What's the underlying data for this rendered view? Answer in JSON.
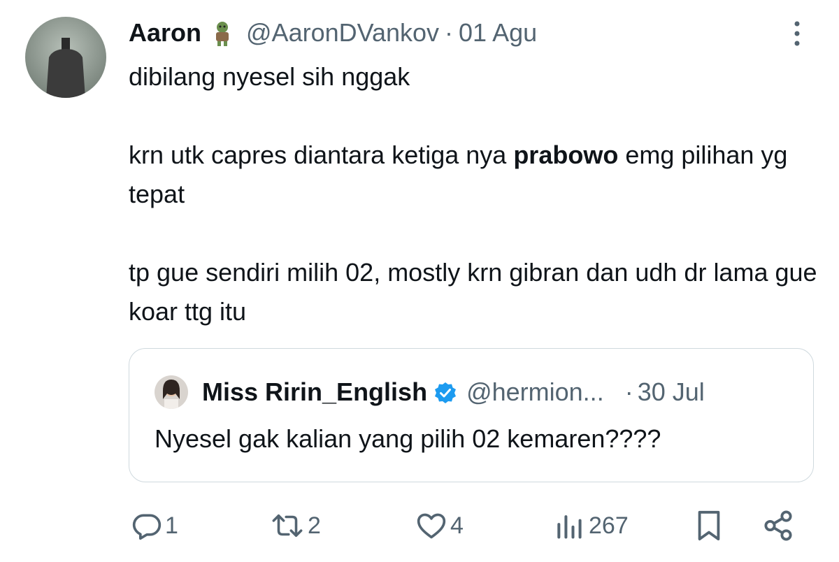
{
  "tweet": {
    "author_name": "Aaron",
    "handle": "@AaronDVankov",
    "separator": "·",
    "date": "01 Agu",
    "line1": "dibilang nyesel sih nggak",
    "line2_pre": "krn utk capres diantara ketiga nya ",
    "line2_bold": "prabowo",
    "line2_post": " emg pilihan yg tepat",
    "line3": "tp gue sendiri milih 02, mostly krn gibran dan udh dr lama gue koar ttg itu"
  },
  "quote": {
    "author_name": "Miss Ririn_English",
    "handle": "@hermion...",
    "separator": "·",
    "date": "30 Jul",
    "text": "Nyesel gak kalian yang pilih 02 kemaren????"
  },
  "actions": {
    "replies": "1",
    "reposts": "2",
    "likes": "4",
    "views": "267"
  },
  "icons": {
    "reply": "reply-icon",
    "repost": "repost-icon",
    "like": "like-icon",
    "views": "views-icon",
    "bookmark": "bookmark-icon",
    "share": "share-icon",
    "more": "more-vertical-icon",
    "verified": "verified-badge-icon"
  },
  "colors": {
    "text": "#0f1419",
    "secondary": "#536471",
    "border": "#cfd9de",
    "verified": "#1d9bf0"
  }
}
